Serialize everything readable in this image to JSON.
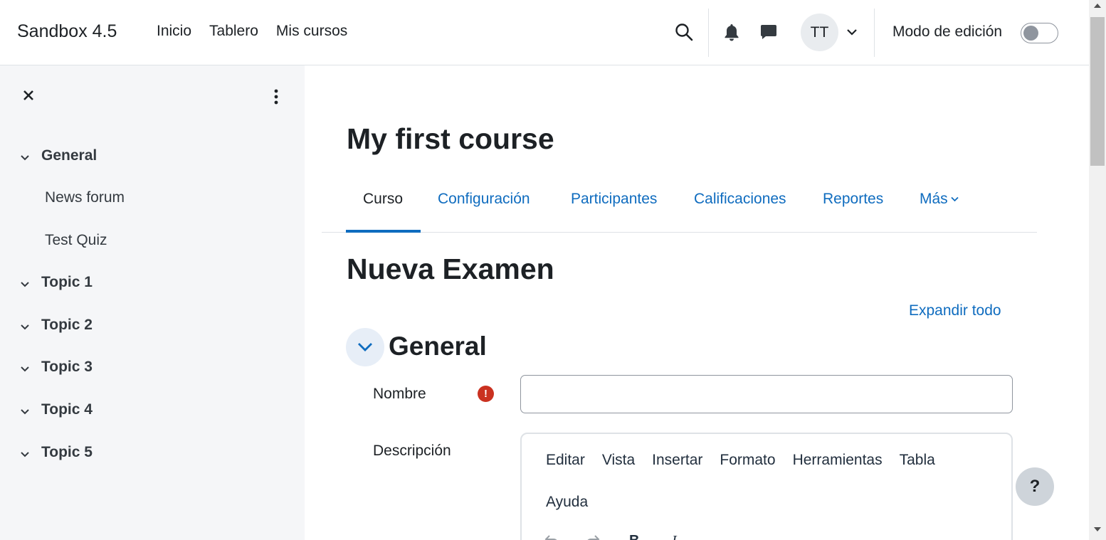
{
  "navbar": {
    "brand": "Sandbox 4.5",
    "primary_nav": [
      "Inicio",
      "Tablero",
      "Mis cursos"
    ],
    "user_initials": "TT",
    "edit_mode_label": "Modo de edición",
    "edit_mode_on": false
  },
  "course_index": {
    "sections": [
      {
        "title": "General",
        "activities": [
          "News forum",
          "Test Quiz"
        ]
      },
      {
        "title": "Topic 1",
        "activities": []
      },
      {
        "title": "Topic 2",
        "activities": []
      },
      {
        "title": "Topic 3",
        "activities": []
      },
      {
        "title": "Topic 4",
        "activities": []
      },
      {
        "title": "Topic 5",
        "activities": []
      }
    ]
  },
  "main": {
    "course_title": "My first course",
    "tabs": [
      {
        "label": "Curso",
        "active": true
      },
      {
        "label": "Configuración",
        "active": false
      },
      {
        "label": "Participantes",
        "active": false
      },
      {
        "label": "Calificaciones",
        "active": false
      },
      {
        "label": "Reportes",
        "active": false
      },
      {
        "label": "Más",
        "active": false
      }
    ],
    "form_title": "Nueva Examen",
    "expand_all": "Expandir todo",
    "fieldset_title": "General",
    "name_label": "Nombre",
    "name_value": "",
    "description_label": "Descripción",
    "editor_menu": [
      "Editar",
      "Vista",
      "Insertar",
      "Formato",
      "Herramientas",
      "Tabla",
      "Ayuda"
    ],
    "help_label": "?"
  },
  "colors": {
    "link": "#0f6cbf",
    "drawer_bg": "#f5f6f8",
    "required": "#ca3120"
  }
}
